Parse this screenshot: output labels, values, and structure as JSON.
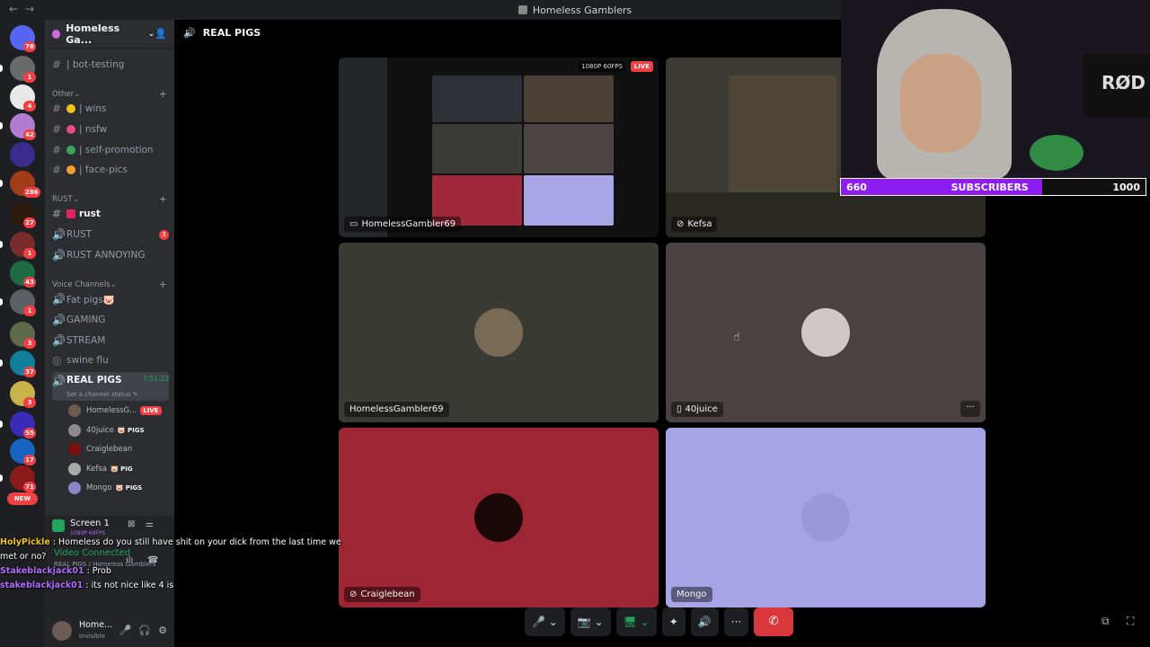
{
  "window": {
    "title": "Homeless Gamblers",
    "nav": "←→"
  },
  "colors": {
    "accent": "#5865f2",
    "live": "#f23f43",
    "green": "#23a55a",
    "sub_fill": "#8d1bf2"
  },
  "rail": {
    "servers": [
      {
        "badge": "78",
        "color": "#5865f2"
      },
      {
        "badge": "1",
        "color": "#6a6a6a"
      },
      {
        "badge": "4",
        "color": "#e8e8e8"
      },
      {
        "badge": "42",
        "color": "#b07bd1"
      },
      {
        "badge": "",
        "color": "#3b2b8f"
      },
      {
        "badge": "286",
        "color": "#a23b1a"
      },
      {
        "badge": "27",
        "color": "#2d1a0f"
      },
      {
        "badge": "1",
        "color": "#7a2c2c"
      },
      {
        "badge": "43",
        "color": "#1e6b43"
      },
      {
        "badge": "1",
        "color": "#5b5f66"
      },
      {
        "badge": "3",
        "color": "#5f6a4d"
      },
      {
        "badge": "37",
        "color": "#0f7f9a"
      },
      {
        "badge": "3",
        "color": "#c8b34a"
      },
      {
        "badge": "55",
        "color": "#3a2bb8"
      },
      {
        "badge": "17",
        "color": "#1565c0"
      },
      {
        "badge": "71",
        "color": "#8b1a1a"
      }
    ],
    "new_label": "NEW"
  },
  "guild": {
    "name": "Homeless Ga...",
    "chevron": "⌄",
    "invite": "👤"
  },
  "channels": {
    "bot_testing": "| bot-testing",
    "cat_other": "Other",
    "wins": "| wins",
    "nsfw": "| nsfw",
    "self_promo": "| self-promotion",
    "face_pics": "| face-pics",
    "cat_rust": "RUST",
    "rust_text": "rust",
    "rust_voice": "RUST",
    "rust_voice_badge": "3",
    "rust_annoying": "RUST ANNOYING",
    "cat_voice": "Voice Channels",
    "fat_pigs": "Fat pigs🐷",
    "gaming": "GAMING",
    "stream": "STREAM",
    "swine_flu": "swine flu",
    "real_pigs": "REAL PIGS",
    "real_pigs_time": "7:51:23",
    "set_status": "Set a channel status ✎",
    "plus": "+",
    "chev": "⌄"
  },
  "voice_users": [
    {
      "name": "HomelessG...",
      "tag": "",
      "live": "LIVE",
      "color": "#6b5b4f"
    },
    {
      "name": "40juice",
      "tag": "🐷 PIGS",
      "live": "",
      "color": "#8a8a8a"
    },
    {
      "name": "Craiglebean",
      "tag": "",
      "live": "",
      "color": "#7a1010"
    },
    {
      "name": "Kefsa",
      "tag": "🐷 PIG",
      "live": "",
      "color": "#aaaaaa"
    },
    {
      "name": "Mongo",
      "tag": "🐷 PIGS",
      "live": "",
      "color": "#8b86c8"
    }
  ],
  "voice_panel": {
    "screen": "Screen 1",
    "quality": "1080P 60FPS",
    "status": "Video Connected",
    "sub": "REAL PIGS / Homeless Gamblers"
  },
  "user_panel": {
    "name": "Home...",
    "status": "Invisible",
    "mic": "🎤",
    "headset": "🎧",
    "gear": "⚙"
  },
  "stage": {
    "header": "REAL PIGS",
    "header_icon": "🔊"
  },
  "tiles": {
    "stream_name": "HomelessGambler69",
    "stream_quality": "1080P 60FPS",
    "stream_live": "LIVE",
    "kefsa": "Kefsa",
    "homeless": "HomelessGambler69",
    "juice": "40juice",
    "craigle": "Craiglebean",
    "mongo": "Mongo",
    "more": "···"
  },
  "controls": {
    "mic": "🎤 ⌄",
    "video": "📷 ⌄",
    "share": "🖥 ⌄",
    "activity": "✦",
    "soundboard": "🔊",
    "more": "···",
    "hangup": "✆",
    "popout": "⧉",
    "fullscreen": "⛶"
  },
  "overlay": {
    "sub_current": "660",
    "sub_label": "SUBSCRIBERS",
    "sub_goal": "1000",
    "sub_fraction": 0.66,
    "mic_brand": "RØD"
  },
  "chat": [
    {
      "user": "HolyPickle",
      "text": " : Homeless do you still have shit on your dick from the last time we met or no?",
      "color": "#f0c419"
    },
    {
      "user": "Stakeblackjack01",
      "text": " : Prob",
      "color": "#b06cff"
    },
    {
      "user": "stakeblackjack01",
      "text": " : its not nice like 4 is",
      "color": "#b06cff"
    }
  ]
}
